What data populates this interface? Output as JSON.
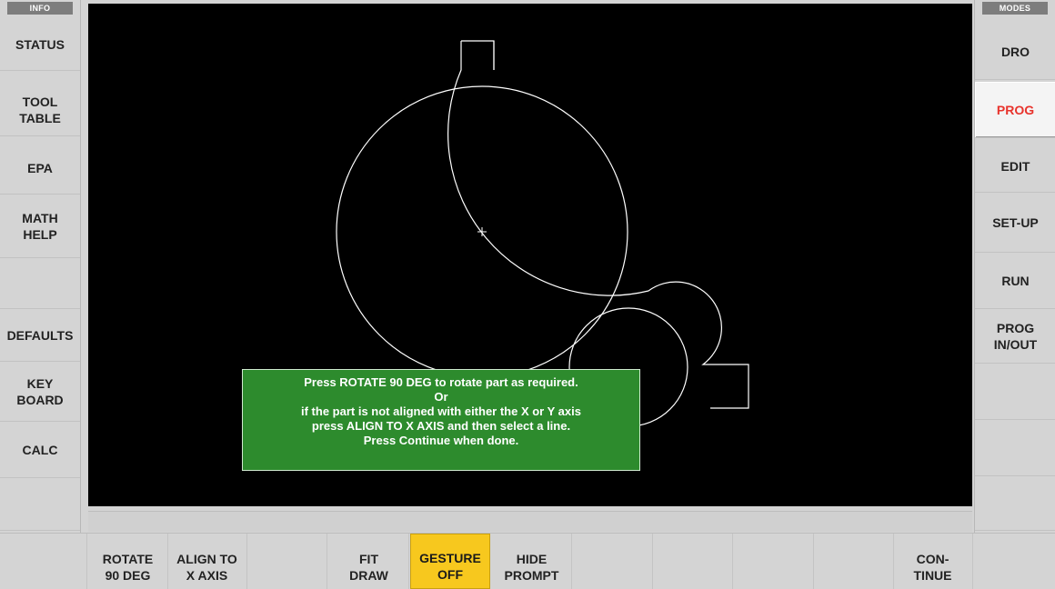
{
  "info_panel": {
    "header": "INFO",
    "items": [
      {
        "label": "STATUS"
      },
      {
        "label": "TOOL\nTABLE"
      },
      {
        "label": "EPA"
      },
      {
        "label": "MATH\nHELP"
      },
      {
        "label": ""
      },
      {
        "label": "DEFAULTS"
      },
      {
        "label": "KEY\nBOARD"
      },
      {
        "label": "CALC"
      },
      {
        "label": ""
      }
    ]
  },
  "modes_panel": {
    "header": "MODES",
    "active_item": "PROG",
    "items": [
      {
        "label": "DRO"
      },
      {
        "label": "PROG"
      },
      {
        "label": "EDIT"
      },
      {
        "label": "SET-UP"
      },
      {
        "label": "RUN"
      },
      {
        "label": "PROG\nIN/OUT"
      },
      {
        "label": ""
      },
      {
        "label": ""
      },
      {
        "label": ""
      }
    ]
  },
  "prompt": {
    "lines": [
      "Press ROTATE 90 DEG to rotate part as required.",
      "Or",
      "if the part is not aligned with either the X or Y axis",
      "press ALIGN TO X AXIS and then select a line.",
      "Press Continue when done."
    ]
  },
  "softkeys": [
    {
      "label": ""
    },
    {
      "label": "ROTATE\n90 DEG"
    },
    {
      "label": "ALIGN TO\nX AXIS"
    },
    {
      "label": ""
    },
    {
      "label": "FIT\nDRAW"
    },
    {
      "label": "GESTURE\nOFF",
      "highlighted": true
    },
    {
      "label": "HIDE\nPROMPT"
    },
    {
      "label": ""
    },
    {
      "label": ""
    },
    {
      "label": ""
    },
    {
      "label": ""
    },
    {
      "label": "CON-\nTINUE"
    },
    {
      "label": ""
    }
  ],
  "colors": {
    "active_mode": "#e8332c",
    "highlight_key": "#f7c81e",
    "prompt_bg": "#2d8b2d",
    "canvas_bg": "#000000"
  }
}
